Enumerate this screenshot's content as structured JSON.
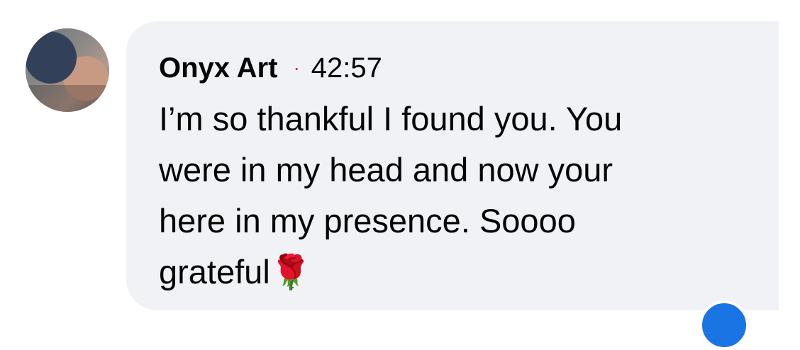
{
  "comment": {
    "author": "Onyx Art",
    "separator": "·",
    "timestamp": "42:57",
    "text": "I’m so thankful I found you. You\nwere in my head and now your\nhere in my presence. Soooo\ngrateful🌹"
  },
  "colors": {
    "bubble_background": "#f0f2f5",
    "text": "#050505",
    "separator_dot": "#e0245e",
    "reaction_badge": "#1b74e4"
  },
  "icons": {
    "avatar": "profile-photo",
    "reaction": "reaction-icon"
  }
}
